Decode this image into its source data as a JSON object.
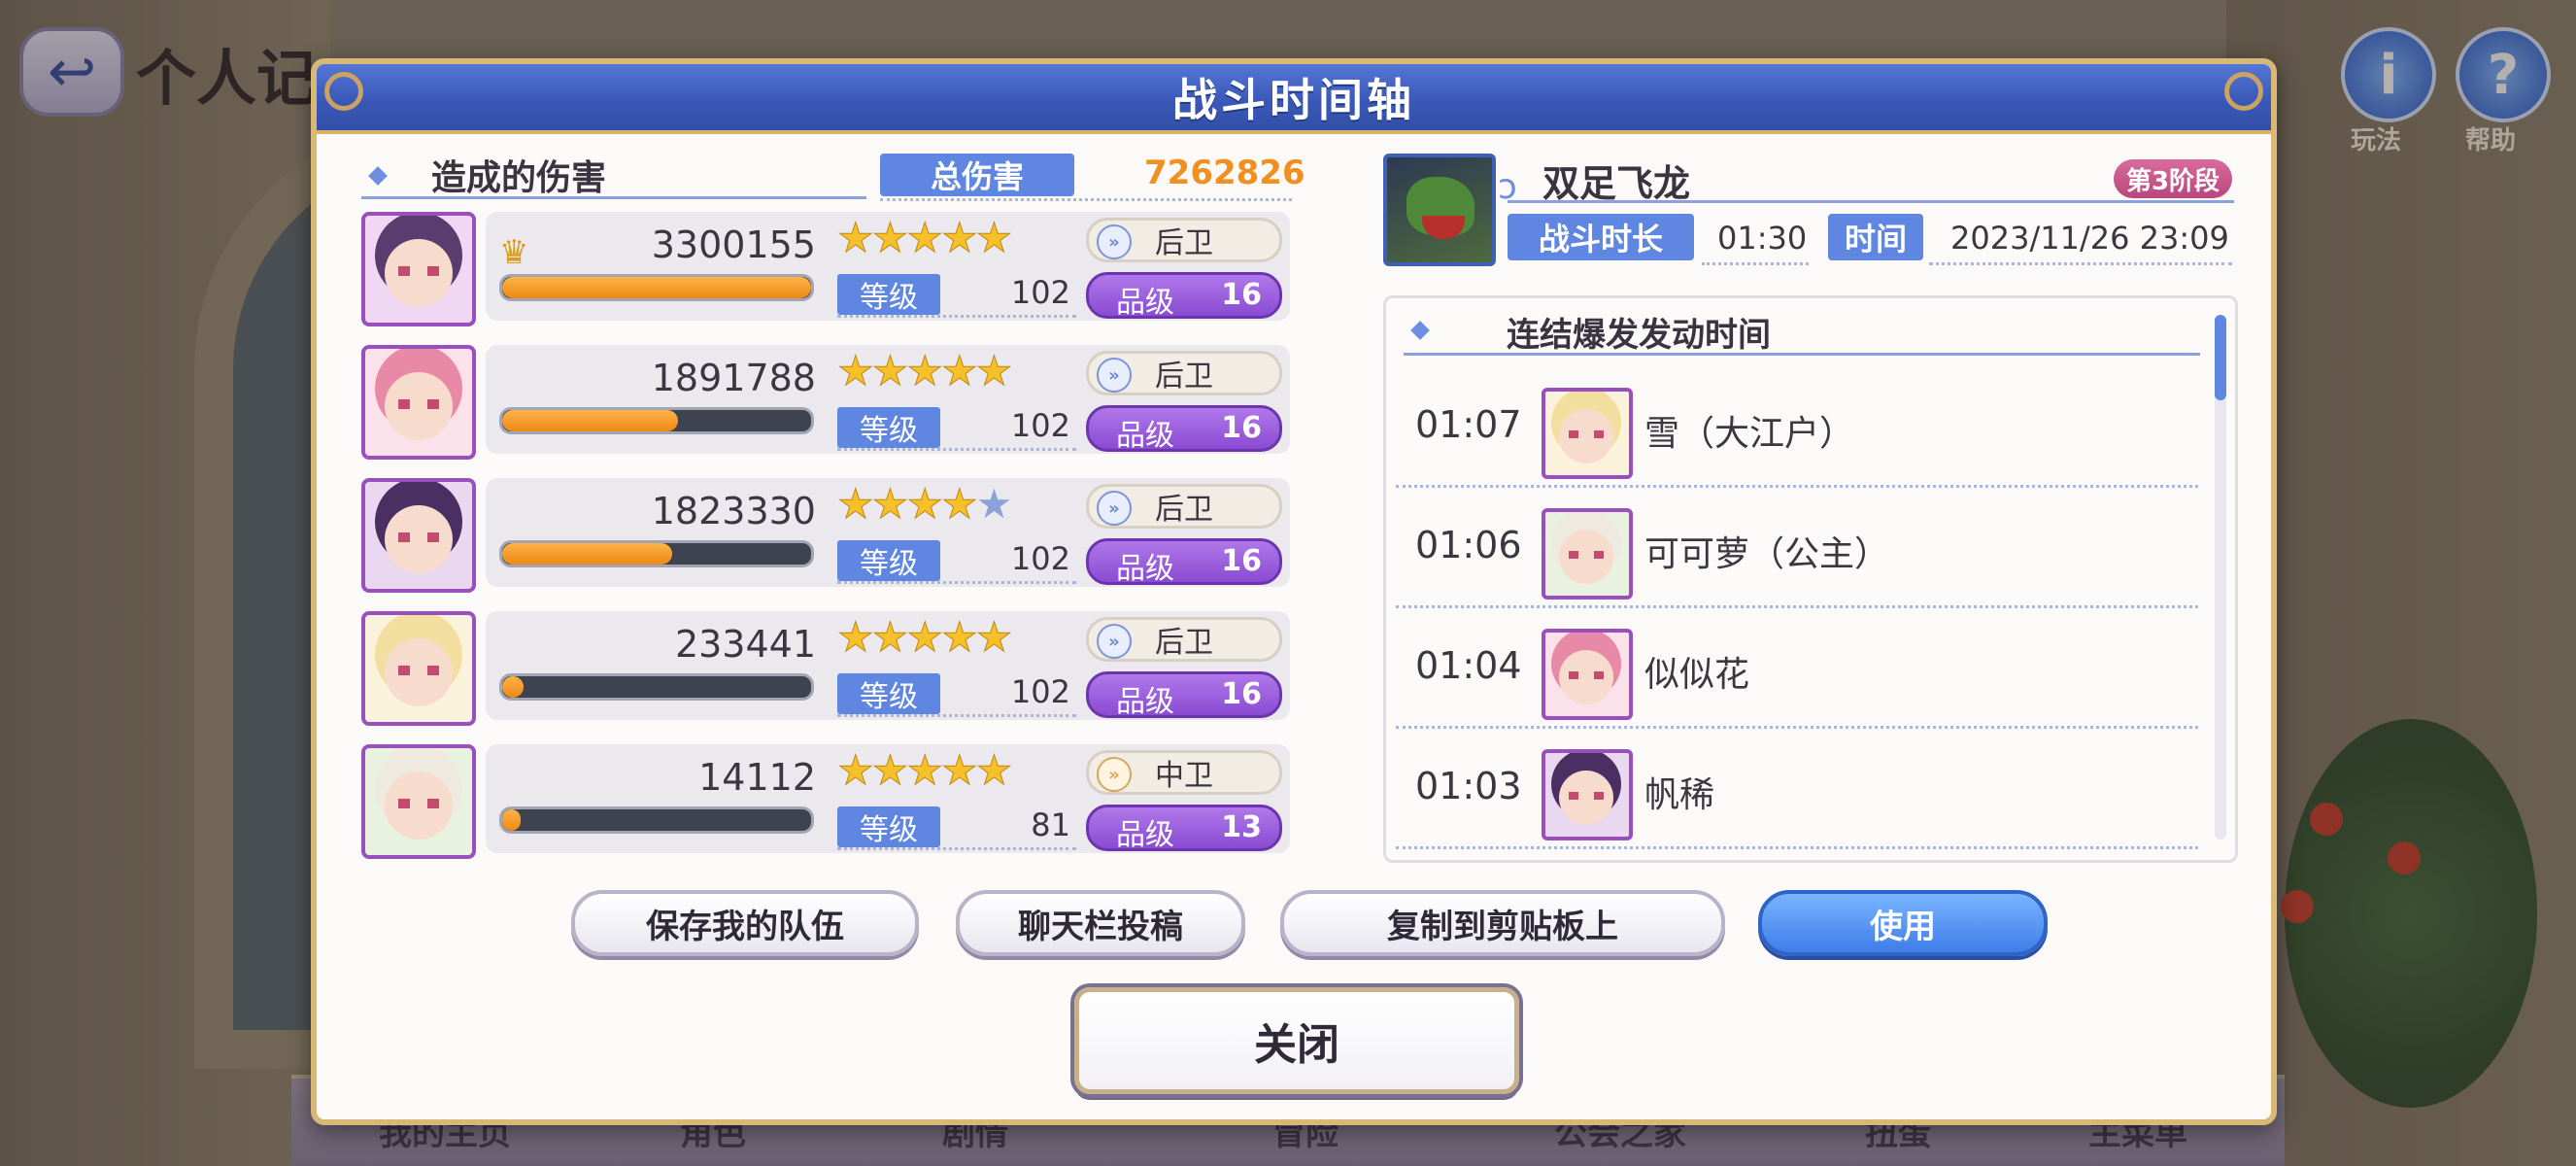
{
  "background": {
    "page_title": "个人记",
    "back_icon": "back-arrow-icon",
    "top_right": [
      {
        "icon": "info-icon",
        "label": "玩法"
      },
      {
        "icon": "question-icon",
        "label": "帮助"
      }
    ],
    "bottom_nav": [
      "我的主页",
      "角色",
      "剧情",
      "冒险",
      "公会之家",
      "扭蛋",
      "主菜单"
    ]
  },
  "dialog": {
    "title": "战斗时间轴",
    "damage_section": {
      "heading": "造成的伤害",
      "total_label": "总伤害",
      "total_value": "7262826",
      "level_label": "等级",
      "rank_label": "品级",
      "characters": [
        {
          "damage": "3300155",
          "damage_fraction": 1.0,
          "stars": 5,
          "max_stars": 5,
          "position": "后卫",
          "level": "102",
          "rank": "16",
          "top": true,
          "hair": "#5a3c6e",
          "bg": "#f0d8f4"
        },
        {
          "damage": "1891788",
          "damage_fraction": 0.57,
          "stars": 5,
          "max_stars": 5,
          "position": "后卫",
          "level": "102",
          "rank": "16",
          "top": false,
          "hair": "#e889a8",
          "bg": "#fbe1ea"
        },
        {
          "damage": "1823330",
          "damage_fraction": 0.55,
          "stars": 4,
          "max_stars": 5,
          "position": "后卫",
          "level": "102",
          "rank": "16",
          "top": false,
          "hair": "#4b2f62",
          "bg": "#e9d8f0"
        },
        {
          "damage": "233441",
          "damage_fraction": 0.07,
          "stars": 5,
          "max_stars": 5,
          "position": "后卫",
          "level": "102",
          "rank": "16",
          "top": false,
          "hair": "#f2dfa0",
          "bg": "#fbf2dc"
        },
        {
          "damage": "14112",
          "damage_fraction": 0.004,
          "stars": 5,
          "max_stars": 5,
          "position": "中卫",
          "level": "81",
          "rank": "13",
          "top": false,
          "hair": "#eeeae0",
          "bg": "#e9f1df"
        }
      ]
    },
    "battle_info": {
      "boss_name": "双足飞龙",
      "phase": "第3阶段",
      "duration_label": "战斗时长",
      "duration_value": "01:30",
      "time_label": "时间",
      "time_value": "2023/11/26  23:09"
    },
    "union_burst": {
      "heading": "连结爆发发动时间",
      "entries": [
        {
          "time": "01:07",
          "name": "雪（大江户）",
          "hair": "#f2dfa0",
          "bg": "#fbf2dc"
        },
        {
          "time": "01:06",
          "name": "可可萝（公主）",
          "hair": "#eeeae0",
          "bg": "#e9f1df"
        },
        {
          "time": "01:04",
          "name": "似似花",
          "hair": "#e889a8",
          "bg": "#fbe1ea"
        },
        {
          "time": "01:03",
          "name": "帆稀",
          "hair": "#4b2f62",
          "bg": "#e9d8f0"
        }
      ]
    },
    "buttons": {
      "save_team": "保存我的队伍",
      "post_chat": "聊天栏投稿",
      "copy_clipboard": "复制到剪贴板上",
      "use": "使用",
      "close": "关闭"
    }
  }
}
